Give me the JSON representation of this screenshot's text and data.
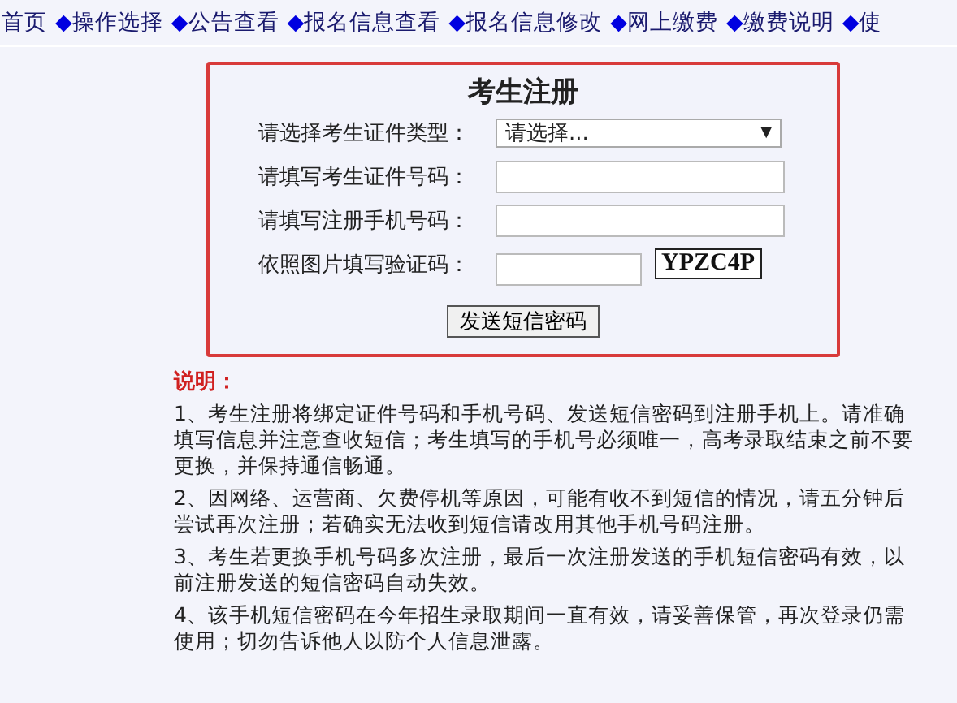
{
  "nav": [
    {
      "label": "首页",
      "kind": "plain"
    },
    {
      "label": "◆操作选择",
      "kind": "diamond"
    },
    {
      "label": "◆公告查看",
      "kind": "diamond"
    },
    {
      "label": "◆报名信息查看",
      "kind": "diamond"
    },
    {
      "label": "◆报名信息修改",
      "kind": "diamond"
    },
    {
      "label": "◆网上缴费",
      "kind": "diamond"
    },
    {
      "label": "◆缴费说明",
      "kind": "diamond"
    },
    {
      "label": "◆使",
      "kind": "diamond"
    }
  ],
  "form": {
    "title": "考生注册",
    "fields": [
      {
        "label": "请选择考生证件类型：",
        "kind": "select",
        "value": "请选择...",
        "caret": "▼"
      },
      {
        "label": "请填写考生证件号码：",
        "kind": "input"
      },
      {
        "label": "请填写注册手机号码：",
        "kind": "input"
      },
      {
        "label": "依照图片填写验证码：",
        "kind": "captcha",
        "code": "YPZC4P"
      }
    ],
    "button": "发送短信密码"
  },
  "notes": {
    "heading": "说明：",
    "items": [
      "1、考生注册将绑定证件号码和手机号码、发送短信密码到注册手机上。请准确填写信息并注意查收短信；考生填写的手机号必须唯一，高考录取结束之前不要更换，并保持通信畅通。",
      "2、因网络、运营商、欠费停机等原因，可能有收不到短信的情况，请五分钟后尝试再次注册；若确实无法收到短信请改用其他手机号码注册。",
      "3、考生若更换手机号码多次注册，最后一次注册发送的手机短信密码有效，以前注册发送的短信密码自动失效。",
      "4、该手机短信密码在今年招生录取期间一直有效，请妥善保管，再次登录仍需使用；切勿告诉他人以防个人信息泄露。"
    ]
  }
}
